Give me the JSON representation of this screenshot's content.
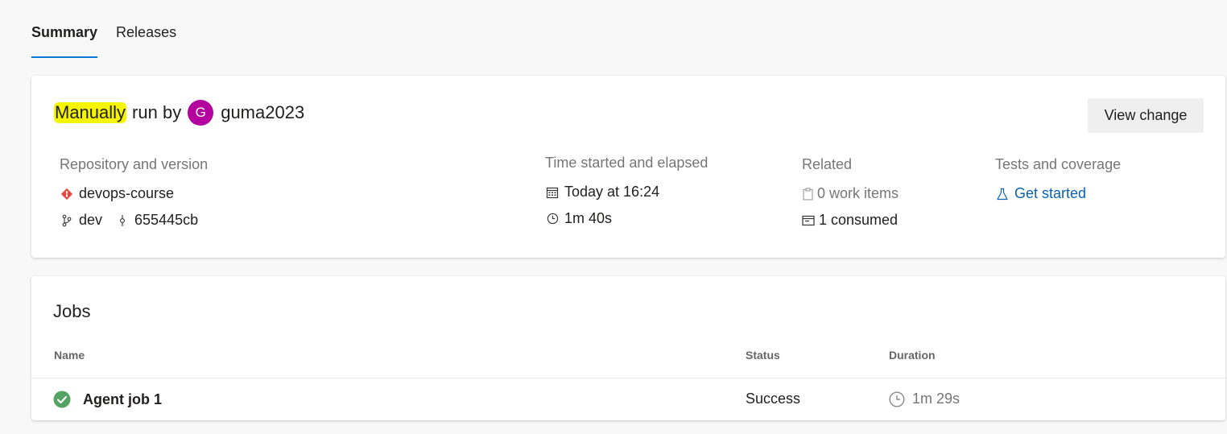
{
  "tabs": [
    {
      "label": "Summary",
      "active": true
    },
    {
      "label": "Releases",
      "active": false
    }
  ],
  "summary": {
    "trigger_highlighted": "Manually",
    "trigger_rest": "run by",
    "user_initial": "G",
    "user_name": "guma2023",
    "view_change_label": "View change",
    "repo": {
      "heading": "Repository and version",
      "name": "devops-course",
      "branch": "dev",
      "commit": "655445cb"
    },
    "time": {
      "heading": "Time started and elapsed",
      "started": "Today at 16:24",
      "elapsed": "1m 40s"
    },
    "related": {
      "heading": "Related",
      "work_items": "0 work items",
      "consumed": "1 consumed"
    },
    "tests": {
      "heading": "Tests and coverage",
      "link": "Get started"
    }
  },
  "jobs": {
    "title": "Jobs",
    "columns": [
      "Name",
      "Status",
      "Duration"
    ],
    "rows": [
      {
        "name": "Agent job 1",
        "status": "Success",
        "duration": "1m 29s"
      }
    ]
  },
  "colors": {
    "accent": "#0078d4",
    "avatar": "#b4009e",
    "success": "#55a362",
    "highlight": "#f5f500",
    "git": "#e2483d",
    "link": "#0a62b0"
  }
}
